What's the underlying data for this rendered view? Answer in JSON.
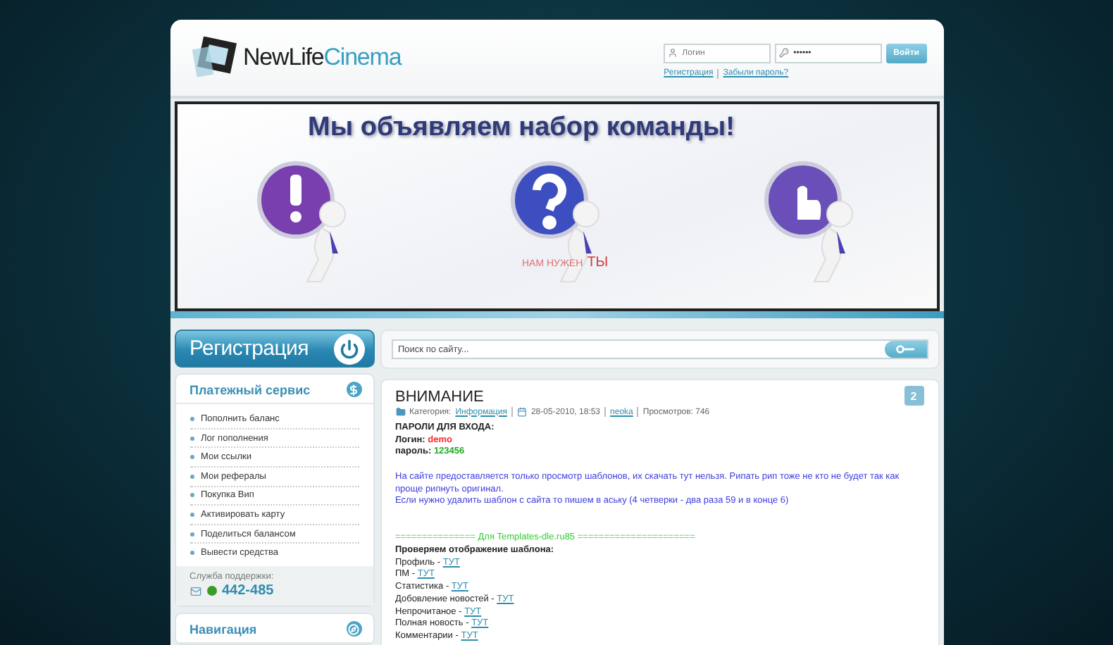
{
  "header": {
    "logo": {
      "first": "NewLife",
      "second": "Cinema"
    },
    "login": {
      "login_placeholder": "Логин",
      "password_value": "••••••",
      "button": "Войти",
      "links": [
        "Регистрация",
        "Забыли пароль?"
      ]
    }
  },
  "banner": {
    "headline": "Мы объявляем набор команды!",
    "tagline_prefix": "НАМ НУЖЕН",
    "tagline_word": "ТЫ"
  },
  "sidebar": {
    "register_button": "Регистрация",
    "payment": {
      "title": "Платежный сервис",
      "items": [
        "Пополнить баланс",
        "Лог пополнения",
        "Мои ссылки",
        "Мои рефералы",
        "Покупка Вип",
        "Активировать карту",
        "Поделиться балансом",
        "Вывести средства"
      ]
    },
    "support": {
      "label": "Служба поддержки:",
      "phone": "442-485"
    },
    "navigation": {
      "title": "Навигация"
    }
  },
  "search": {
    "placeholder": "Поиск по сайту..."
  },
  "post": {
    "title": "ВНИМАНИЕ",
    "comments": "2",
    "meta": {
      "category_label": "Категория:",
      "category": "Информация",
      "date": "28-05-2010, 18:53",
      "author": "neoka",
      "views": "Просмотров: 746"
    },
    "body": [
      {
        "kind": "bold",
        "text": "ПАРОЛИ ДЛЯ ВХОДА:"
      },
      {
        "kind": "pair",
        "label": "Логин:",
        "value": "demo",
        "color": "#ff2a2a"
      },
      {
        "kind": "pair",
        "label": "пароль:",
        "value": "123456",
        "color": "#22aa22"
      },
      {
        "kind": "gap"
      },
      {
        "kind": "notice",
        "text": "На сайте предоставляется только просмотр шаблонов, их скачать тут нельзя. Рипать рип тоже не кто не будет так как проще рипнуть оригинал."
      },
      {
        "kind": "notice",
        "text": "Если нужно удалить шаблон с сайта то пишем в аську (4 четверки - два раза 59 и в конце 6)"
      },
      {
        "kind": "gap"
      },
      {
        "kind": "gap"
      },
      {
        "kind": "divider",
        "text": "=============== Для Templates-dle.ru85 ======================"
      },
      {
        "kind": "bold",
        "text": "Проверяем отображение шаблона:"
      },
      {
        "kind": "link",
        "label": "Профиль -",
        "link": "ТУТ"
      },
      {
        "kind": "link",
        "label": "ПМ -",
        "link": "ТУТ"
      },
      {
        "kind": "link",
        "label": "Статистика -",
        "link": "ТУТ"
      },
      {
        "kind": "link",
        "label": "Добовление новостей -",
        "link": "ТУТ"
      },
      {
        "kind": "link",
        "label": "Непрочитаное -",
        "link": "ТУТ"
      },
      {
        "kind": "link",
        "label": "Полная новость -",
        "link": "ТУТ"
      },
      {
        "kind": "link",
        "label": "Комментарии -",
        "link": "ТУТ"
      }
    ]
  }
}
